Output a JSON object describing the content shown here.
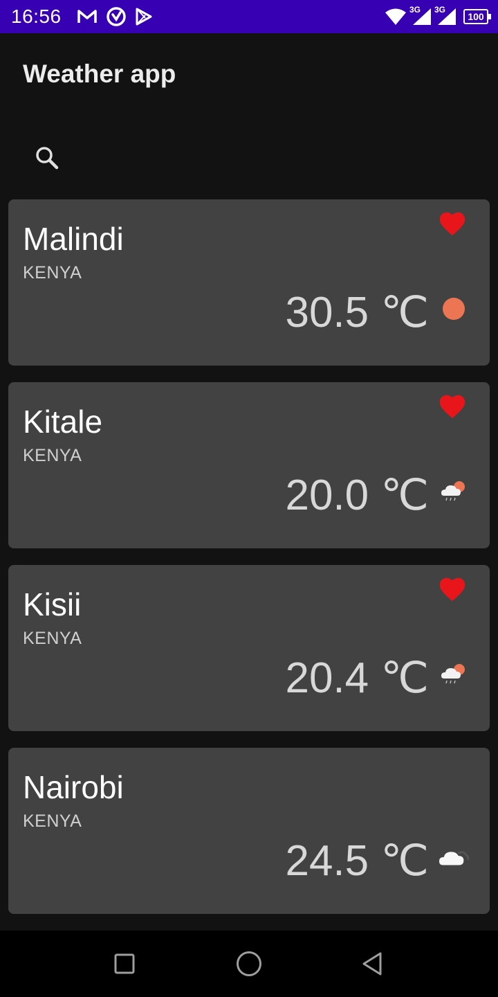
{
  "status_bar": {
    "time": "16:56",
    "left_icons": [
      "gmail-icon",
      "app-notification-icon",
      "play-store-icon"
    ],
    "right_icons": [
      "wifi-icon",
      "signal-3g-icon",
      "signal-3g-icon"
    ],
    "network_1": "3G",
    "network_2": "3G",
    "battery": "100",
    "background_color": "#3700b3"
  },
  "app_bar": {
    "title": "Weather app"
  },
  "search": {
    "icon": "search-icon"
  },
  "cities": [
    {
      "name": "Malindi",
      "country": "KENYA",
      "temperature": "30.5 ℃",
      "weather_icon": "sunny-icon",
      "favorite": true
    },
    {
      "name": "Kitale",
      "country": "KENYA",
      "temperature": "20.0 ℃",
      "weather_icon": "partly-cloudy-rain-icon",
      "favorite": true
    },
    {
      "name": "Kisii",
      "country": "KENYA",
      "temperature": "20.4 ℃",
      "weather_icon": "partly-cloudy-rain-icon",
      "favorite": true
    },
    {
      "name": "Nairobi",
      "country": "KENYA",
      "temperature": "24.5 ℃",
      "weather_icon": "cloudy-icon",
      "favorite": false
    }
  ],
  "colors": {
    "favorite": "#e8161b",
    "sun": "#ec7554",
    "card": "#424242",
    "background": "#121212"
  },
  "nav_bar": {
    "buttons": [
      "recents-icon",
      "home-icon",
      "back-icon"
    ]
  }
}
